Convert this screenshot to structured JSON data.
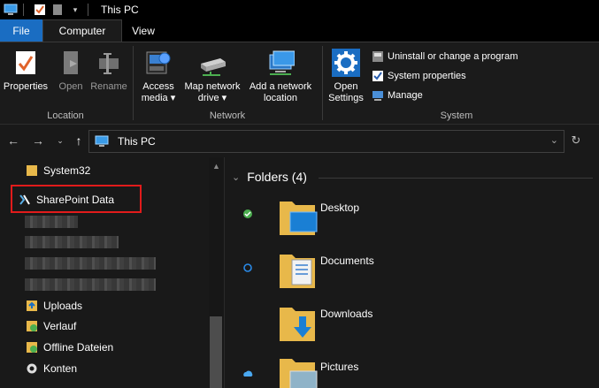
{
  "window": {
    "title": "This PC"
  },
  "tabs": {
    "file": "File",
    "computer": "Computer",
    "view": "View"
  },
  "ribbon": {
    "location": {
      "label": "Location",
      "properties": "Properties",
      "open": "Open",
      "rename": "Rename"
    },
    "network": {
      "label": "Network",
      "access_media_1": "Access",
      "access_media_2": "media",
      "map_drive_1": "Map network",
      "map_drive_2": "drive",
      "add_location_1": "Add a network",
      "add_location_2": "location"
    },
    "system": {
      "label": "System",
      "open_settings_1": "Open",
      "open_settings_2": "Settings",
      "uninstall": "Uninstall or change a program",
      "system_properties": "System properties",
      "manage": "Manage"
    }
  },
  "address": {
    "path": "This PC"
  },
  "nav": {
    "system32": "System32",
    "sharepoint": "SharePoint Data",
    "uploads": "Uploads",
    "verlauf": "Verlauf",
    "offline": "Offline Dateien",
    "konten": "Konten"
  },
  "content": {
    "section": "Folders (4)",
    "folders": [
      "Desktop",
      "Documents",
      "Downloads",
      "Pictures"
    ]
  },
  "colors": {
    "accent": "#1a6dc2",
    "highlight": "#e11b1b",
    "folder": "#e8b84a"
  }
}
